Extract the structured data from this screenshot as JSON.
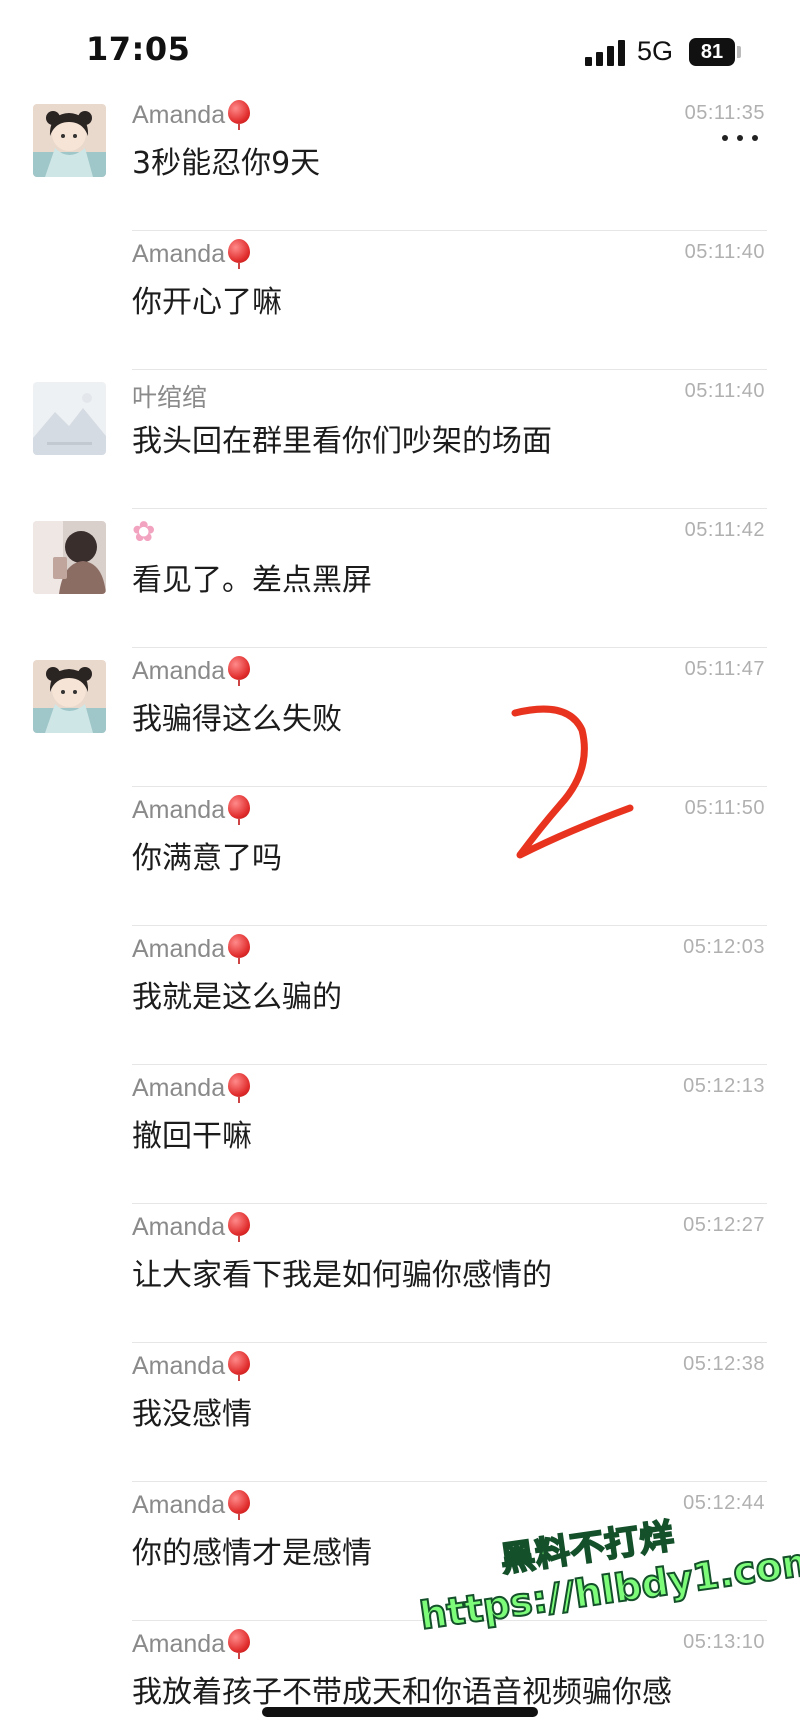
{
  "status_bar": {
    "time": "17:05",
    "network": "5G",
    "battery": "81"
  },
  "more_icon": "more-horizontal-icon",
  "messages": [
    {
      "sender": "Amanda",
      "badge": "balloon-icon",
      "time": "05:11:35",
      "text": "3秒能忍你9天",
      "avatar": "anime-girl"
    },
    {
      "sender": "Amanda",
      "badge": "balloon-icon",
      "time": "05:11:40",
      "text": "你开心了嘛",
      "avatar": ""
    },
    {
      "sender": "叶绾绾",
      "badge": "",
      "time": "05:11:40",
      "text": "我头回在群里看你们吵架的场面",
      "avatar": "landscape"
    },
    {
      "sender": "",
      "badge": "flower-icon",
      "time": "05:11:42",
      "text": "看见了。差点黑屏",
      "avatar": "photo"
    },
    {
      "sender": "Amanda",
      "badge": "balloon-icon",
      "time": "05:11:47",
      "text": "我骗得这么失败",
      "avatar": "anime-girl"
    },
    {
      "sender": "Amanda",
      "badge": "balloon-icon",
      "time": "05:11:50",
      "text": "你满意了吗",
      "avatar": ""
    },
    {
      "sender": "Amanda",
      "badge": "balloon-icon",
      "time": "05:12:03",
      "text": "我就是这么骗的",
      "avatar": ""
    },
    {
      "sender": "Amanda",
      "badge": "balloon-icon",
      "time": "05:12:13",
      "text": "撤回干嘛",
      "avatar": ""
    },
    {
      "sender": "Amanda",
      "badge": "balloon-icon",
      "time": "05:12:27",
      "text": "让大家看下我是如何骗你感情的",
      "avatar": ""
    },
    {
      "sender": "Amanda",
      "badge": "balloon-icon",
      "time": "05:12:38",
      "text": "我没感情",
      "avatar": ""
    },
    {
      "sender": "Amanda",
      "badge": "balloon-icon",
      "time": "05:12:44",
      "text": "你的感情才是感情",
      "avatar": ""
    },
    {
      "sender": "Amanda",
      "badge": "balloon-icon",
      "time": "05:13:10",
      "text": "我放着孩子不带成天和你语音视频骗你感",
      "avatar": ""
    }
  ],
  "annotation": {
    "label": "2",
    "color": "#e8331f"
  },
  "watermark": {
    "title": "黑料不打烊",
    "url": "https://hlbdy1.com",
    "color": "#7dfc7a"
  }
}
